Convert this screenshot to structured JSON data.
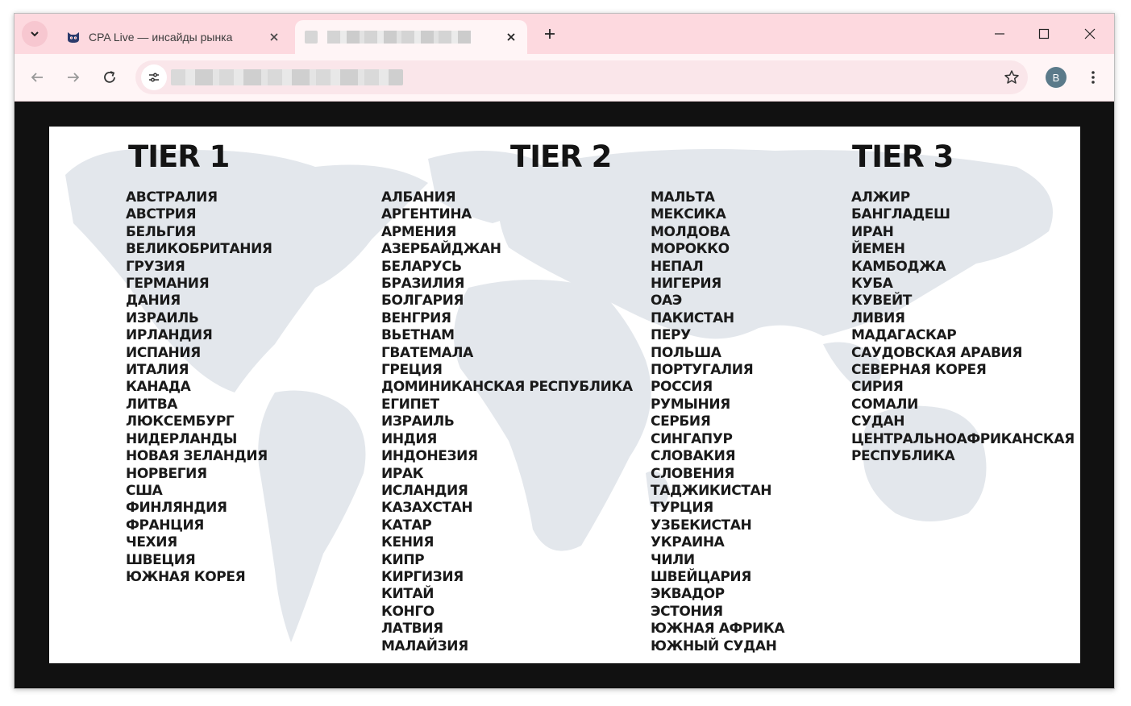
{
  "browser": {
    "tabs": [
      {
        "title": "CPA Live — инсайды рынка",
        "active": false
      },
      {
        "title": "",
        "active": true
      }
    ],
    "profile_initial": "B",
    "colors": {
      "tabbar": "#fdd9df",
      "toolbar": "#fff5f6",
      "page_bg": "#111111",
      "avatar": "#5b7a8a"
    }
  },
  "tiers": [
    {
      "heading": "TIER 1",
      "columns": [
        [
          "АВСТРАЛИЯ",
          "АВСТРИЯ",
          "БЕЛЬГИЯ",
          "ВЕЛИКОБРИТАНИЯ",
          "ГРУЗИЯ",
          "ГЕРМАНИЯ",
          "ДАНИЯ",
          "ИЗРАИЛЬ",
          "ИРЛАНДИЯ",
          "ИСПАНИЯ",
          "ИТАЛИЯ",
          "КАНАДА",
          "ЛИТВА",
          "ЛЮКСЕМБУРГ",
          "НИДЕРЛАНДЫ",
          "НОВАЯ ЗЕЛАНДИЯ",
          "НОРВЕГИЯ",
          "США",
          "ФИНЛЯНДИЯ",
          "ФРАНЦИЯ",
          "ЧЕХИЯ",
          "ШВЕЦИЯ",
          "ЮЖНАЯ КОРЕЯ"
        ]
      ]
    },
    {
      "heading": "TIER 2",
      "columns": [
        [
          "АЛБАНИЯ",
          "АРГЕНТИНА",
          "АРМЕНИЯ",
          "АЗЕРБАЙДЖАН",
          "БЕЛАРУСЬ",
          "БРАЗИЛИЯ",
          "БОЛГАРИЯ",
          "ВЕНГРИЯ",
          "ВЬЕТНАМ",
          "ГВАТЕМАЛА",
          "ГРЕЦИЯ",
          "ДОМИНИКАНСКАЯ РЕСПУБЛИКА",
          "ЕГИПЕТ",
          "ИЗРАИЛЬ",
          "ИНДИЯ",
          "ИНДОНЕЗИЯ",
          "ИРАК",
          "ИСЛАНДИЯ",
          "КАЗАХСТАН",
          "КАТАР",
          "КЕНИЯ",
          "КИПР",
          "КИРГИЗИЯ",
          "КИТАЙ",
          "КОНГО",
          "ЛАТВИЯ",
          "МАЛАЙЗИЯ"
        ],
        [
          "МАЛЬТА",
          "МЕКСИКА",
          "МОЛДОВА",
          "МОРОККО",
          "НЕПАЛ",
          "НИГЕРИЯ",
          "ОАЭ",
          "ПАКИСТАН",
          "ПЕРУ",
          "ПОЛЬША",
          "ПОРТУГАЛИЯ",
          "РОССИЯ",
          "РУМЫНИЯ",
          "СЕРБИЯ",
          "СИНГАПУР",
          "СЛОВАКИЯ",
          "СЛОВЕНИЯ",
          "ТАДЖИКИСТАН",
          "ТУРЦИЯ",
          "УЗБЕКИСТАН",
          "УКРАИНА",
          "ЧИЛИ",
          "ШВЕЙЦАРИЯ",
          "ЭКВАДОР",
          "ЭСТОНИЯ",
          "ЮЖНАЯ АФРИКА",
          "ЮЖНЫЙ СУДАН"
        ]
      ]
    },
    {
      "heading": "TIER 3",
      "columns": [
        [
          "АЛЖИР",
          "БАНГЛАДЕШ",
          "ИРАН",
          "ЙЕМЕН",
          "КАМБОДЖА",
          "КУБА",
          "КУВЕЙТ",
          "ЛИВИЯ",
          "МАДАГАСКАР",
          "САУДОВСКАЯ АРАВИЯ",
          "СЕВЕРНАЯ КОРЕЯ",
          "СИРИЯ",
          "СОМАЛИ",
          "СУДАН",
          "ЦЕНТРАЛЬНОАФРИКАНСКАЯ",
          "РЕСПУБЛИКА"
        ]
      ]
    }
  ]
}
